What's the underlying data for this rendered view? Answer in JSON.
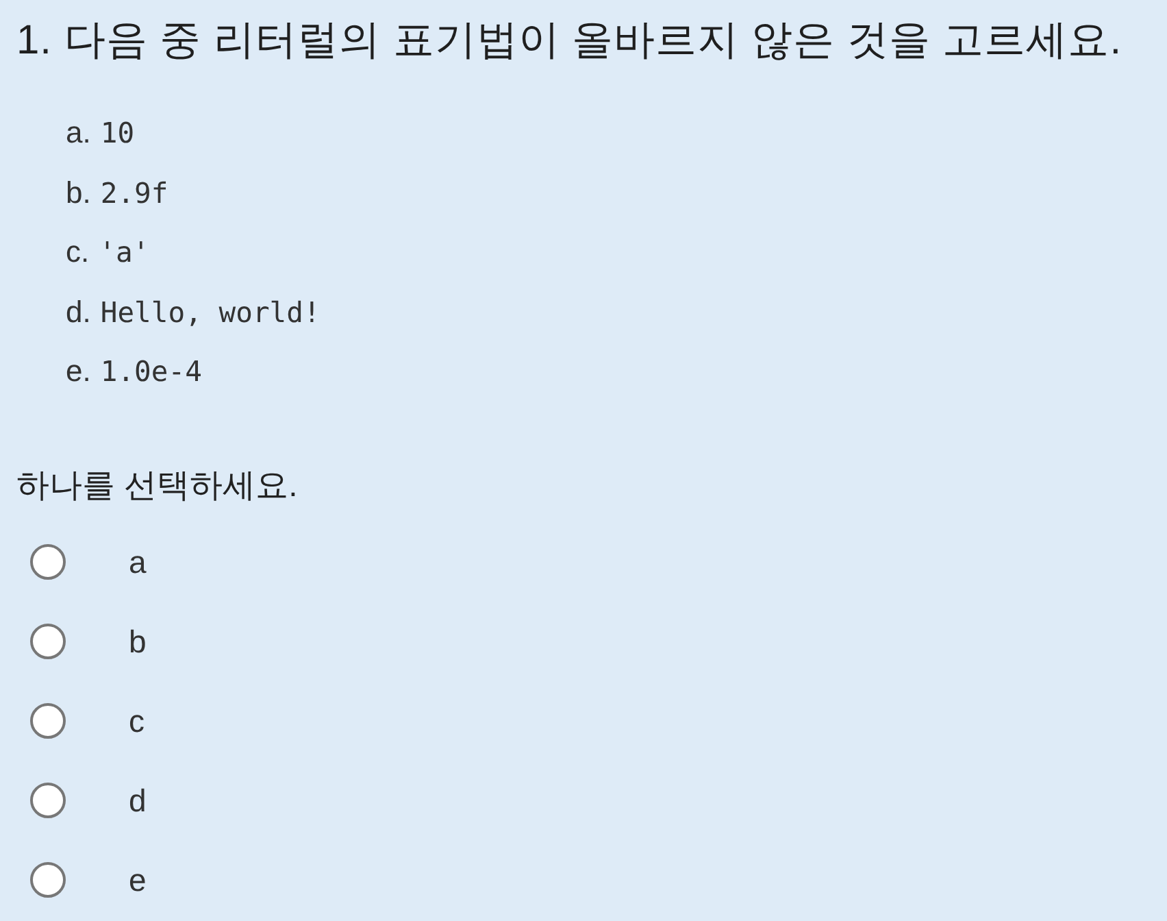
{
  "question": {
    "text": "1. 다음 중 리터럴의 표기법이 올바르지 않은 것을 고르세요."
  },
  "choices": [
    {
      "letter": "a.",
      "code": "10"
    },
    {
      "letter": "b.",
      "code": "2.9f"
    },
    {
      "letter": "c.",
      "code": "'a'"
    },
    {
      "letter": "d.",
      "code": "Hello, world!"
    },
    {
      "letter": "e.",
      "code": "1.0e-4"
    }
  ],
  "prompt": "하나를 선택하세요.",
  "answers": [
    {
      "label": "a",
      "selected": false
    },
    {
      "label": "b",
      "selected": false
    },
    {
      "label": "c",
      "selected": false
    },
    {
      "label": "d",
      "selected": false
    },
    {
      "label": "e",
      "selected": false
    }
  ]
}
